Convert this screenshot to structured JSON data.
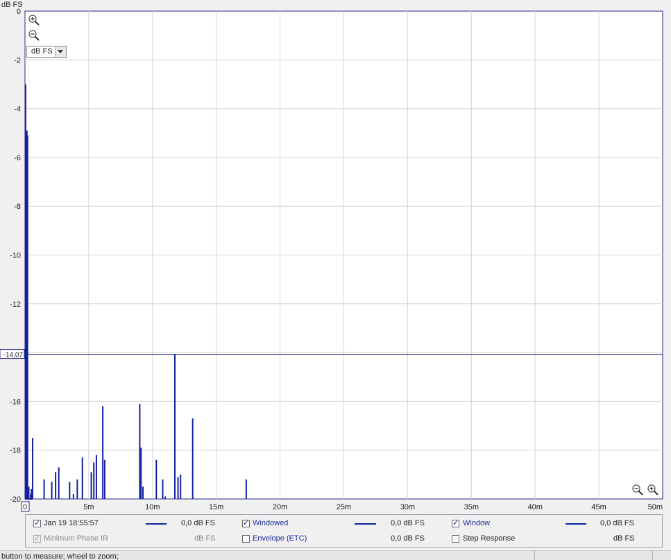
{
  "chart_data": {
    "type": "line",
    "title": "",
    "ylabel": "dB FS",
    "xlabel": "",
    "xlim": [
      0,
      50
    ],
    "ylim": [
      -20,
      0
    ],
    "x_ticks": [
      0,
      5,
      10,
      15,
      20,
      25,
      30,
      35,
      40,
      45,
      50
    ],
    "x_tick_labels": [
      "0",
      "5m",
      "10m",
      "15m",
      "20m",
      "25m",
      "30m",
      "35m",
      "40m",
      "45m",
      "50m"
    ],
    "y_ticks": [
      0,
      -2,
      -4,
      -6,
      -8,
      -10,
      -12,
      -16,
      -18,
      -20
    ],
    "y_tick_labels": [
      "0",
      "-2",
      "-4",
      "-6",
      "-8",
      "-10",
      "-12",
      "-16",
      "-18",
      "-20"
    ],
    "cursor_value": -14.07,
    "cursor_label": "-14,07",
    "grid": true,
    "series": [
      {
        "name": "Jan 19 18:55:57",
        "color": "#1020a0",
        "impulses": [
          [
            0.05,
            -3.0
          ],
          [
            0.1,
            -5.0
          ],
          [
            0.15,
            -4.9
          ],
          [
            0.2,
            -5.1
          ],
          [
            0.3,
            -19.5
          ],
          [
            0.45,
            -19.8
          ],
          [
            0.5,
            -19.6
          ],
          [
            0.6,
            -17.5
          ],
          [
            1.5,
            -19.2
          ],
          [
            1.8,
            -20.0
          ],
          [
            2.1,
            -19.3
          ],
          [
            2.4,
            -18.9
          ],
          [
            2.65,
            -18.7
          ],
          [
            3.5,
            -19.3
          ],
          [
            3.8,
            -19.8
          ],
          [
            4.1,
            -19.2
          ],
          [
            4.5,
            -18.3
          ],
          [
            5.2,
            -18.9
          ],
          [
            5.4,
            -18.5
          ],
          [
            5.6,
            -18.2
          ],
          [
            6.1,
            -16.2
          ],
          [
            6.25,
            -18.4
          ],
          [
            9.0,
            -16.1
          ],
          [
            9.1,
            -17.9
          ],
          [
            9.25,
            -19.5
          ],
          [
            10.3,
            -18.4
          ],
          [
            10.8,
            -19.2
          ],
          [
            11.0,
            -19.9
          ],
          [
            11.75,
            -14.07
          ],
          [
            12.0,
            -19.1
          ],
          [
            12.2,
            -19.0
          ],
          [
            13.15,
            -16.7
          ],
          [
            17.35,
            -19.2
          ]
        ]
      }
    ]
  },
  "unit_select": {
    "value": "dB FS"
  },
  "legend": {
    "row1": [
      {
        "label": "Jan 19 18:55:57",
        "checked": true,
        "value": "0,0 dB FS",
        "swatch": true
      },
      {
        "label": "Windowed",
        "checked": true,
        "value": "0,0 dB FS",
        "swatch": true
      },
      {
        "label": "Window",
        "checked": true,
        "value": "0,0 dB FS",
        "swatch": true
      }
    ],
    "row2": [
      {
        "label": "Minimum Phase IR",
        "checked": true,
        "disabled": true,
        "value": "dB FS"
      },
      {
        "label": "Envelope (ETC)",
        "checked": false,
        "value": "0,0 dB FS"
      },
      {
        "label": "Step Response",
        "checked": false,
        "value": "dB FS"
      }
    ]
  },
  "status": {
    "text": "button to measure; wheel to zoom;"
  },
  "icons": [
    "zoom-in-icon",
    "zoom-out-icon"
  ]
}
